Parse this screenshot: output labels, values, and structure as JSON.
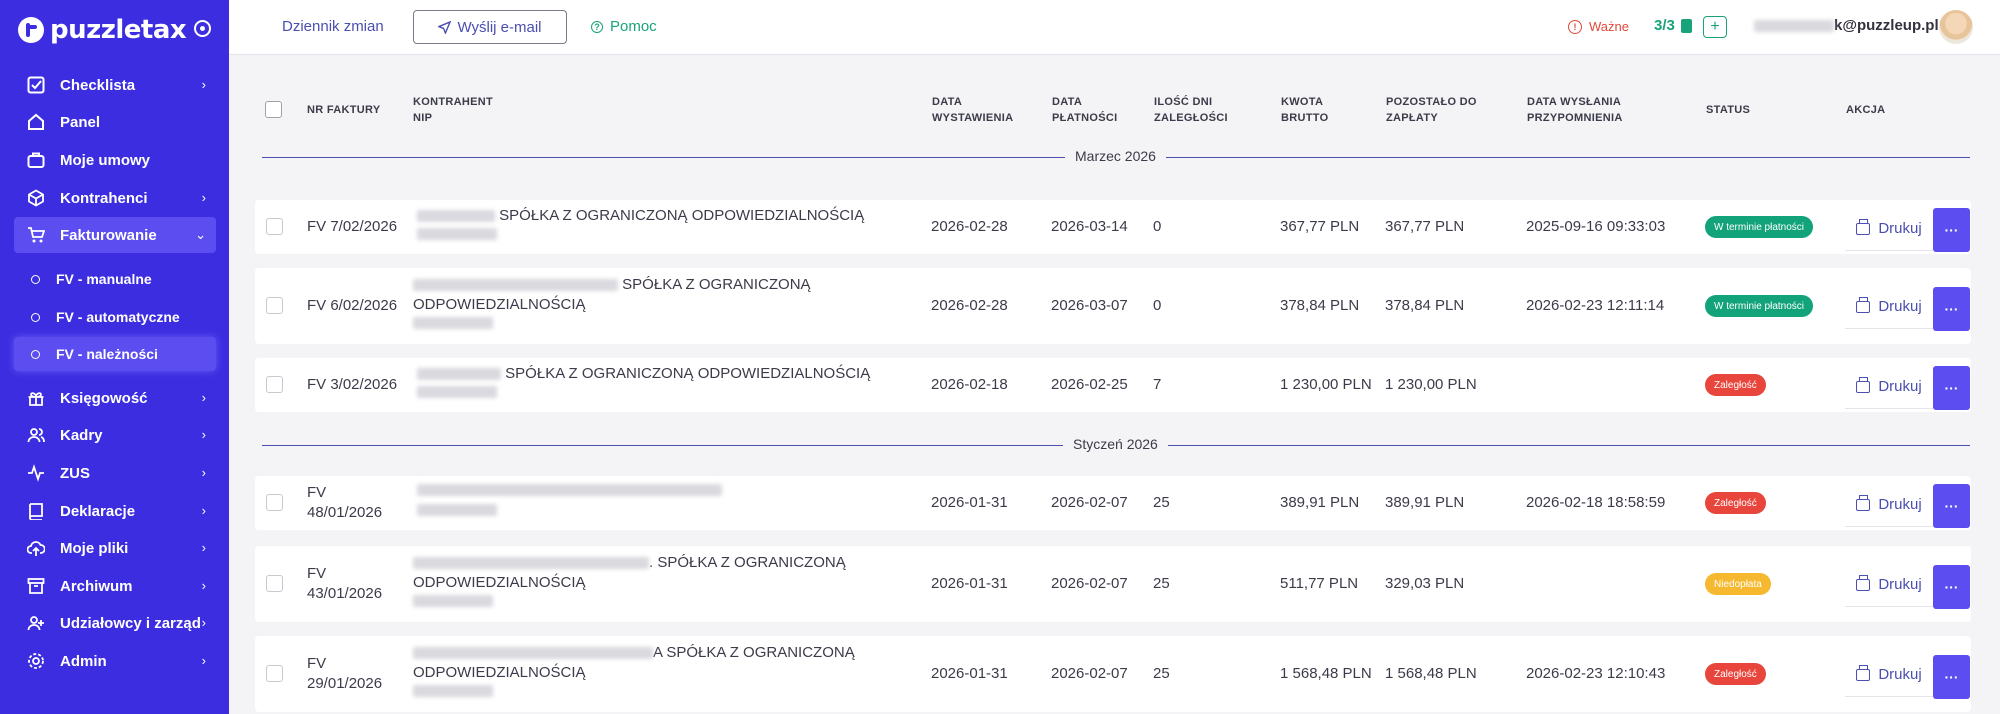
{
  "brand": {
    "name": "puzzletax"
  },
  "sidebar": {
    "items": [
      {
        "label": "Checklista",
        "icon": "checklist-icon",
        "chevron": "›"
      },
      {
        "label": "Panel",
        "icon": "home-icon",
        "chevron": ""
      },
      {
        "label": "Moje umowy",
        "icon": "briefcase-icon",
        "chevron": ""
      },
      {
        "label": "Kontrahenci",
        "icon": "box-icon",
        "chevron": "›"
      },
      {
        "label": "Fakturowanie",
        "icon": "cart-icon",
        "chevron": "⌄"
      },
      {
        "label": "Księgowość",
        "icon": "calculator-icon",
        "chevron": "›"
      },
      {
        "label": "Kadry",
        "icon": "users-icon",
        "chevron": "›"
      },
      {
        "label": "ZUS",
        "icon": "activity-icon",
        "chevron": "›"
      },
      {
        "label": "Deklaracje",
        "icon": "book-icon",
        "chevron": "›"
      },
      {
        "label": "Moje pliki",
        "icon": "cloud-upload-icon",
        "chevron": "›"
      },
      {
        "label": "Archiwum",
        "icon": "archive-icon",
        "chevron": "›"
      },
      {
        "label": "Udziałowcy i zarząd",
        "icon": "user-plus-icon",
        "chevron": "›"
      },
      {
        "label": "Admin",
        "icon": "settings-icon",
        "chevron": "›"
      }
    ],
    "subitems": [
      {
        "label": "FV - manualne"
      },
      {
        "label": "FV - automatyczne"
      },
      {
        "label": "FV - należności"
      }
    ]
  },
  "topbar": {
    "changelog": "Dziennik zmian",
    "send_email": "Wyślij e-mail",
    "help": "Pomoc",
    "important": "Ważne",
    "count": "3/3",
    "plus": "+",
    "email_suffix": "k@puzzleup.pl"
  },
  "table": {
    "headers": {
      "invoice_no": "NR FAKTURY",
      "contractor_1": "KONTRAHENT",
      "contractor_2": "NIP",
      "issue_1": "DATA",
      "issue_2": "WYSTAWIENIA",
      "pay_1": "DATA",
      "pay_2": "PŁATNOŚCI",
      "overdue_1": "ILOŚĆ DNI",
      "overdue_2": "ZALEGŁOŚCI",
      "gross_1": "KWOTA",
      "gross_2": "BRUTTO",
      "remaining_1": "POZOSTAŁO DO",
      "remaining_2": "ZAPŁATY",
      "reminder_1": "DATA WYSŁANIA",
      "reminder_2": "PRZYPOMNIENIA",
      "status": "STATUS",
      "action": "AKCJA"
    },
    "groups": [
      {
        "label": "Marzec 2026"
      },
      {
        "label": "Styczeń 2026"
      }
    ],
    "rows": [
      {
        "invoice": "FV 7/02/2026",
        "contractor_line1": "SPÓŁKA Z OGRANICZONĄ ODPOWIEDZIALNOŚCIĄ",
        "contractor_line2": "",
        "issue": "2026-02-28",
        "payment": "2026-03-14",
        "overdue": "0",
        "gross": "367,77 PLN",
        "remaining": "367,77 PLN",
        "reminder": "2025-09-16 09:33:03",
        "status": "W terminie płatności",
        "status_color": "#12a37b",
        "print": "Drukuj",
        "more": "···"
      },
      {
        "invoice": "FV 6/02/2026",
        "contractor_line1": "SPÓŁKA Z OGRANICZONĄ",
        "contractor_line2": "ODPOWIEDZIALNOŚCIĄ",
        "issue": "2026-02-28",
        "payment": "2026-03-07",
        "overdue": "0",
        "gross": "378,84 PLN",
        "remaining": "378,84 PLN",
        "reminder": "2026-02-23 12:11:14",
        "status": "W terminie płatności",
        "status_color": "#12a37b",
        "print": "Drukuj",
        "more": "···"
      },
      {
        "invoice": "FV 3/02/2026",
        "contractor_line1": "SPÓŁKA Z OGRANICZONĄ ODPOWIEDZIALNOŚCIĄ",
        "contractor_line2": "",
        "issue": "2026-02-18",
        "payment": "2026-02-25",
        "overdue": "7",
        "gross": "1 230,00 PLN",
        "remaining": "1 230,00 PLN",
        "reminder": "",
        "status": "Zaległość",
        "status_color": "#e8453c",
        "print": "Drukuj",
        "more": "···"
      },
      {
        "invoice_1": "FV",
        "invoice_2": "48/01/2026",
        "contractor_line1": "",
        "contractor_line2": "",
        "issue": "2026-01-31",
        "payment": "2026-02-07",
        "overdue": "25",
        "gross": "389,91 PLN",
        "remaining": "389,91 PLN",
        "reminder": "2026-02-18 18:58:59",
        "status": "Zaległość",
        "status_color": "#e8453c",
        "print": "Drukuj",
        "more": "···"
      },
      {
        "invoice_1": "FV",
        "invoice_2": "43/01/2026",
        "contractor_line1": ". SPÓŁKA Z OGRANICZONĄ",
        "contractor_line2": "ODPOWIEDZIALNOŚCIĄ",
        "issue": "2026-01-31",
        "payment": "2026-02-07",
        "overdue": "25",
        "gross": "511,77 PLN",
        "remaining": "329,03 PLN",
        "reminder": "",
        "status": "Niedopłata",
        "status_color": "#f5b82e",
        "print": "Drukuj",
        "more": "···"
      },
      {
        "invoice_1": "FV",
        "invoice_2": "29/01/2026",
        "contractor_line1": "A SPÓŁKA Z OGRANICZONĄ",
        "contractor_line2": "ODPOWIEDZIALNOŚCIĄ",
        "issue": "2026-01-31",
        "payment": "2026-02-07",
        "overdue": "25",
        "gross": "1 568,48 PLN",
        "remaining": "1 568,48 PLN",
        "reminder": "2026-02-23 12:10:43",
        "status": "Zaległość",
        "status_color": "#e8453c",
        "print": "Drukuj",
        "more": "···"
      }
    ]
  }
}
